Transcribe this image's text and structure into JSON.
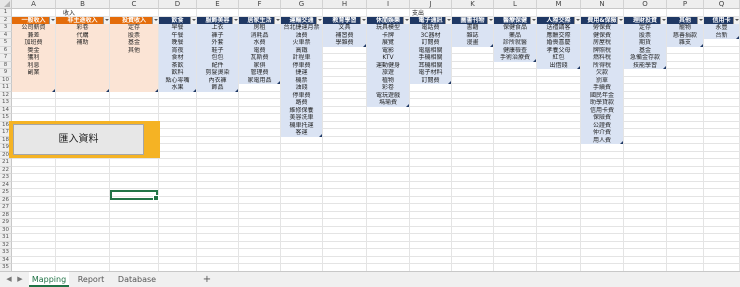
{
  "sheet": {
    "columns": [
      "A",
      "B",
      "C",
      "D",
      "E",
      "F",
      "G",
      "H",
      "I",
      "J",
      "K",
      "L",
      "M",
      "N",
      "O",
      "P",
      "Q"
    ],
    "rows": [
      "1",
      "2",
      "3",
      "4",
      "5",
      "6",
      "7",
      "8",
      "9",
      "10",
      "11",
      "12",
      "13",
      "14",
      "15",
      "16",
      "17",
      "18",
      "19",
      "20",
      "21",
      "22",
      "23",
      "24",
      "25",
      "26",
      "27",
      "28",
      "29",
      "30",
      "31",
      "32",
      "33",
      "34",
      "35"
    ],
    "group_income": "收入",
    "group_expense": "支出",
    "category_columns": [
      {
        "header": "一般收入",
        "style": "orange",
        "items": [
          "公司薪資",
          "兼差",
          "加班費",
          "獎金",
          "獲利",
          "利息",
          "副業"
        ]
      },
      {
        "header": "非主途收入",
        "style": "orange",
        "items": [
          "彩卷",
          "代購",
          "補助"
        ]
      },
      {
        "header": "投資收入",
        "style": "orange",
        "items": [
          "定存",
          "股票",
          "基金",
          "其他"
        ]
      },
      {
        "header": "飲食",
        "style": "blue",
        "items": [
          "早餐",
          "午餐",
          "晚餐",
          "宵夜",
          "食材",
          "茶飲",
          "飲料",
          "點心零嘴",
          "水果"
        ]
      },
      {
        "header": "服飾美容",
        "style": "blue",
        "items": [
          "上衣",
          "褲子",
          "外套",
          "鞋子",
          "包包",
          "配件",
          "剪髮燙染",
          "內衣褲",
          "飾品"
        ]
      },
      {
        "header": "居家生活",
        "style": "blue",
        "items": [
          "房租",
          "消耗品",
          "水費",
          "電費",
          "瓦斯費",
          "家俱",
          "管理費",
          "家電用品"
        ]
      },
      {
        "header": "運輸交通",
        "style": "blue",
        "items": [
          "台北捷運月票",
          "油費",
          "火車票",
          "高鐵",
          "計程車",
          "停車費",
          "捷運",
          "機票",
          "油錢",
          "停車費",
          "路費",
          "維修保養",
          "美容洗車",
          "機車托運",
          "客運"
        ]
      },
      {
        "header": "教育學習",
        "style": "blue",
        "items": [
          "文具",
          "補習費",
          "學雜費"
        ]
      },
      {
        "header": "休閒娛樂",
        "style": "blue",
        "items": [
          "玩具模型",
          "卡牌",
          "展覽",
          "電影",
          "KTV",
          "運動健身",
          "旅遊",
          "植物",
          "彩卷",
          "電玩遊戲",
          "瑪瑜費"
        ]
      },
      {
        "header": "電子通訊",
        "style": "blue",
        "items": [
          "電話費",
          "3C器材",
          "訂閱費",
          "電腦相關",
          "手機相關",
          "耳機相關",
          "電子材料",
          "訂閱費"
        ]
      },
      {
        "header": "圖書刊物",
        "style": "blue",
        "items": [
          "書籍",
          "雜誌",
          "漫畫"
        ]
      },
      {
        "header": "醫療保健",
        "style": "blue",
        "items": [
          "保健食品",
          "藥品",
          "診所就醫",
          "健康檢查",
          "手術治療費"
        ]
      },
      {
        "header": "人際交際",
        "style": "blue",
        "items": [
          "送禮請客",
          "應酬交際",
          "婚喪喜慶",
          "孝養父母",
          "紅包",
          "出借錢"
        ]
      },
      {
        "header": "費用&保險",
        "style": "blue",
        "items": [
          "勞保費",
          "健保費",
          "房屋稅",
          "牌照稅",
          "燃料稅",
          "所得稅",
          "欠款",
          "罰單",
          "手續費",
          "國民年金",
          "助學貸款",
          "信用卡費",
          "保險費",
          "公證費",
          "仲介費",
          "用人費"
        ]
      },
      {
        "header": "理財投資",
        "style": "blue",
        "items": [
          "定存",
          "股票",
          "期貨",
          "基金",
          "急備金存款",
          "技能學習"
        ]
      },
      {
        "header": "其他",
        "style": "blue",
        "items": [
          "寵物",
          "慈善捐款",
          "雜支"
        ]
      },
      {
        "header": "信用卡",
        "style": "blue",
        "items": [
          "永豐",
          "台新"
        ]
      }
    ],
    "import_button_label": "匯入資料"
  },
  "tabs": [
    {
      "label": "Mapping",
      "active": true
    },
    {
      "label": "Report",
      "active": false
    },
    {
      "label": "Database",
      "active": false
    }
  ],
  "nav": {
    "prev": "◀",
    "next": "▶",
    "add": "+"
  },
  "colors": {
    "income_header": "#e46c0a",
    "expense_header": "#1f3864",
    "income_fill": "#fbe4d5",
    "expense_fill": "#dae3f3",
    "button_frame": "#f5b324",
    "active_tab": "#217346"
  }
}
